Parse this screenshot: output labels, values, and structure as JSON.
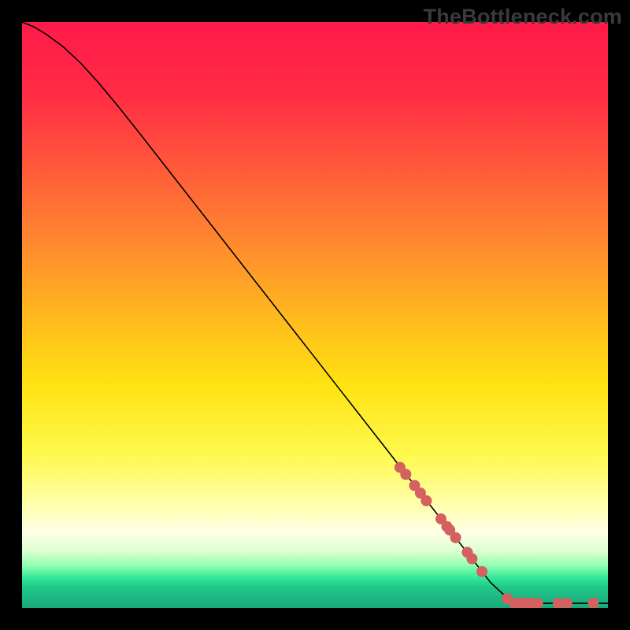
{
  "watermark": "TheBottleneck.com",
  "chart_data": {
    "type": "line",
    "title": "",
    "xlabel": "",
    "ylabel": "",
    "xlim": [
      0,
      100
    ],
    "ylim": [
      0,
      100
    ],
    "grid": false,
    "legend": false,
    "background_gradient": [
      {
        "pos": 0.0,
        "color": "#ff1a4a"
      },
      {
        "pos": 0.12,
        "color": "#ff2b45"
      },
      {
        "pos": 0.25,
        "color": "#ff5a3a"
      },
      {
        "pos": 0.38,
        "color": "#ff8a2f"
      },
      {
        "pos": 0.5,
        "color": "#ffb81e"
      },
      {
        "pos": 0.62,
        "color": "#ffe312"
      },
      {
        "pos": 0.74,
        "color": "#fff94f"
      },
      {
        "pos": 0.82,
        "color": "#ffffa8"
      },
      {
        "pos": 0.872,
        "color": "#ffffe8"
      },
      {
        "pos": 0.905,
        "color": "#d8ffcf"
      },
      {
        "pos": 0.928,
        "color": "#8fffb0"
      },
      {
        "pos": 0.948,
        "color": "#35e89a"
      },
      {
        "pos": 0.965,
        "color": "#20c78a"
      },
      {
        "pos": 1.0,
        "color": "#1aa879"
      }
    ],
    "series": [
      {
        "name": "curve",
        "stroke": "#000000",
        "stroke_width": 1.6,
        "x": [
          0,
          2,
          4,
          7,
          10,
          13,
          16,
          20,
          25,
          30,
          35,
          40,
          45,
          50,
          55,
          60,
          65,
          70,
          75,
          80,
          82.5,
          85,
          87,
          89,
          91,
          93,
          95,
          97,
          100
        ],
        "y": [
          100,
          99.2,
          98.0,
          95.8,
          93.0,
          89.7,
          86.1,
          81.1,
          74.7,
          68.3,
          61.9,
          55.5,
          49.1,
          42.7,
          36.3,
          29.9,
          23.5,
          17.1,
          10.7,
          4.3,
          2.0,
          0.8,
          0.8,
          0.8,
          0.8,
          0.8,
          0.8,
          0.8,
          0.8
        ]
      }
    ],
    "markers": {
      "name": "highlight-points",
      "color": "#d46060",
      "radius": 7,
      "points": [
        {
          "x": 64.5,
          "y": 24.0
        },
        {
          "x": 65.5,
          "y": 22.8
        },
        {
          "x": 67.0,
          "y": 20.9
        },
        {
          "x": 68.0,
          "y": 19.6
        },
        {
          "x": 69.0,
          "y": 18.3
        },
        {
          "x": 71.5,
          "y": 15.2
        },
        {
          "x": 72.5,
          "y": 13.9
        },
        {
          "x": 73.0,
          "y": 13.3
        },
        {
          "x": 74.0,
          "y": 12.0
        },
        {
          "x": 76.0,
          "y": 9.5
        },
        {
          "x": 76.8,
          "y": 8.4
        },
        {
          "x": 78.5,
          "y": 6.2
        },
        {
          "x": 82.8,
          "y": 1.6
        },
        {
          "x": 84.0,
          "y": 0.8
        },
        {
          "x": 85.0,
          "y": 0.8
        },
        {
          "x": 86.0,
          "y": 0.8
        },
        {
          "x": 87.0,
          "y": 0.8
        },
        {
          "x": 88.0,
          "y": 0.8
        },
        {
          "x": 91.5,
          "y": 0.8
        },
        {
          "x": 93.0,
          "y": 0.8
        },
        {
          "x": 97.5,
          "y": 0.8
        }
      ]
    }
  }
}
